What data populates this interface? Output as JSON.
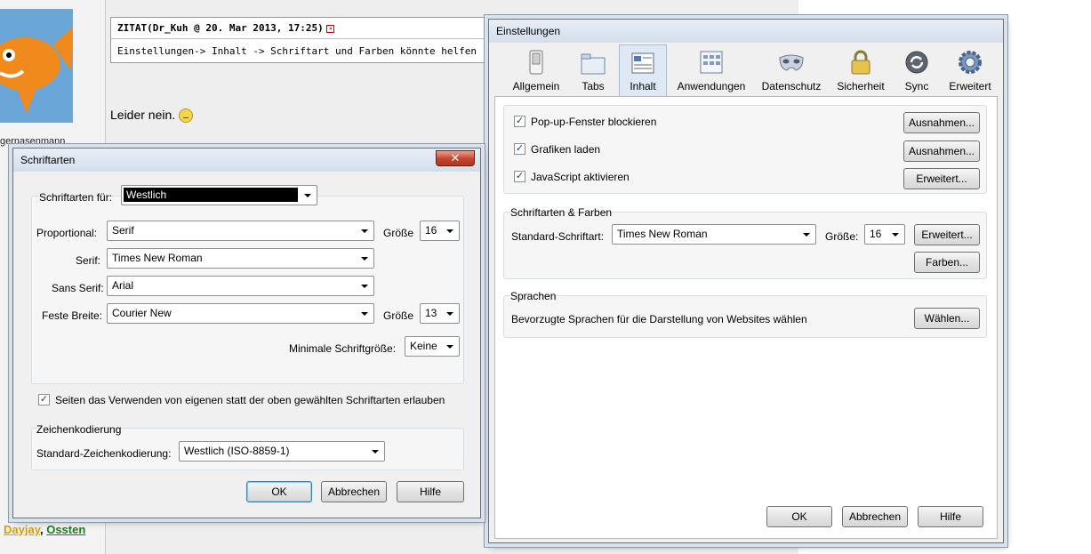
{
  "forum": {
    "quote_header": "ZITAT(Dr_Kuh @ 20. Mar 2013, 17:25)",
    "quote_body": "Einstellungen-> Inhalt -> Schriftart und Farben könnte helfen",
    "reply": "Leider nein.",
    "user_fragment": "gernasenmann",
    "link1": "Dayjay",
    "link_sep": ",",
    "link2": "Ossten"
  },
  "fonts_dialog": {
    "title": "Schriftarten",
    "close_glyph": "✕",
    "fonts_for_label": "Schriftarten für:",
    "fonts_for_value": "Westlich",
    "proportional_label": "Proportional:",
    "proportional_value": "Serif",
    "size_label": "Größe",
    "proportional_size": "16",
    "serif_label": "Serif:",
    "serif_value": "Times New Roman",
    "sans_label": "Sans Serif:",
    "sans_value": "Arial",
    "mono_label": "Feste Breite:",
    "mono_value": "Courier New",
    "mono_size": "13",
    "min_size_label": "Minimale Schriftgröße:",
    "min_size_value": "Keine",
    "allow_pages_label": "Seiten das Verwenden von eigenen statt der oben gewählten Schriftarten erlauben",
    "allow_pages_checked": true,
    "encoding_group": "Zeichenkodierung",
    "encoding_label": "Standard-Zeichenkodierung:",
    "encoding_value": "Westlich (ISO-8859-1)",
    "ok": "OK",
    "cancel": "Abbrechen",
    "help": "Hilfe"
  },
  "settings_dialog": {
    "title": "Einstellungen",
    "tabs": [
      {
        "label": "Allgemein",
        "icon": "switch-icon"
      },
      {
        "label": "Tabs",
        "icon": "folder-tabs-icon"
      },
      {
        "label": "Inhalt",
        "icon": "content-page-icon"
      },
      {
        "label": "Anwendungen",
        "icon": "applications-icon"
      },
      {
        "label": "Datenschutz",
        "icon": "mask-icon"
      },
      {
        "label": "Sicherheit",
        "icon": "lock-icon"
      },
      {
        "label": "Sync",
        "icon": "sync-icon"
      },
      {
        "label": "Erweitert",
        "icon": "gear-icon"
      }
    ],
    "active_tab": "Inhalt",
    "check_glyph": "✓",
    "popup_label": "Pop-up-Fenster blockieren",
    "images_label": "Grafiken laden",
    "js_label": "JavaScript aktivieren",
    "exceptions1": "Ausnahmen...",
    "exceptions2": "Ausnahmen...",
    "advanced_js": "Erweitert...",
    "fonts_group": "Schriftarten & Farben",
    "default_font_label": "Standard-Schriftart:",
    "default_font_value": "Times New Roman",
    "size_label": "Größe:",
    "size_value": "16",
    "advanced_fonts": "Erweitert...",
    "colors": "Farben...",
    "languages_group": "Sprachen",
    "languages_text": "Bevorzugte Sprachen für die Darstellung von Websites wählen",
    "choose": "Wählen...",
    "ok": "OK",
    "cancel": "Abbrechen",
    "help": "Hilfe"
  }
}
